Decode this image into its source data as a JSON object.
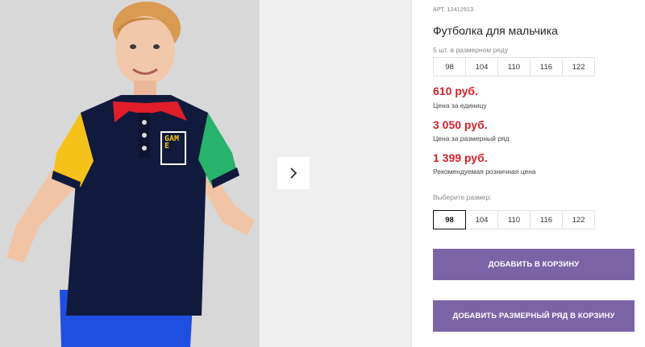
{
  "product": {
    "sku": "АРТ. 12412913",
    "title": "Футболка для мальчика",
    "pack_label": "5 шт. в размерном ряду",
    "pack_sizes": [
      "98",
      "104",
      "110",
      "116",
      "122"
    ],
    "prices": [
      {
        "value": "610 руб.",
        "note": "Цена за единицу"
      },
      {
        "value": "3 050 руб.",
        "note": "Цена за размерный ряд"
      },
      {
        "value": "1 399 руб.",
        "note": "Рекомендуемая розничная цена"
      }
    ],
    "choose_size_label": "Выберите размер:",
    "sizes": [
      "98",
      "104",
      "110",
      "116",
      "122"
    ],
    "selected_size": "98",
    "shirt_logo_text": "GAME",
    "colors": {
      "price": "#d6202b",
      "button": "#7b64a6"
    }
  },
  "actions": {
    "add_to_cart": "ДОБАВИТЬ В КОРЗИНУ",
    "add_pack_to_cart": "ДОБАВИТЬ РАЗМЕРНЫЙ РЯД В КОРЗИНУ"
  },
  "icons": {
    "next": "chevron-right-icon"
  }
}
